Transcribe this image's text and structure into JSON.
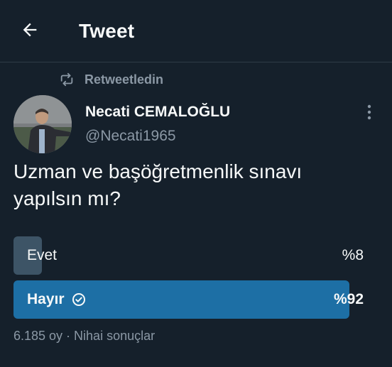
{
  "header": {
    "title": "Tweet",
    "back_icon": "arrow-left-icon"
  },
  "retweet": {
    "label": "Retweetledin",
    "icon": "retweet-icon"
  },
  "author": {
    "name": "Necati CEMALOĞLU",
    "handle": "@Necati1965",
    "avatar": "user-photo",
    "more_icon": "more-vertical-icon"
  },
  "tweet": {
    "text": "Uzman ve başöğretmenlik sınavı yapılsın mı?"
  },
  "poll": {
    "options": [
      {
        "label": "Evet",
        "percent_label": "%8",
        "percent": 8,
        "winner": false
      },
      {
        "label": "Hayır",
        "percent_label": "%92",
        "percent": 92,
        "winner": true
      }
    ],
    "footer": "6.185 oy · Nihai sonuçlar",
    "colors": {
      "winner_bar": "#1d6fa5",
      "other_bar": "#3d5466"
    }
  },
  "colors": {
    "background": "#15202b",
    "text_primary": "#f7f9f9",
    "text_secondary": "#8b98a5"
  }
}
